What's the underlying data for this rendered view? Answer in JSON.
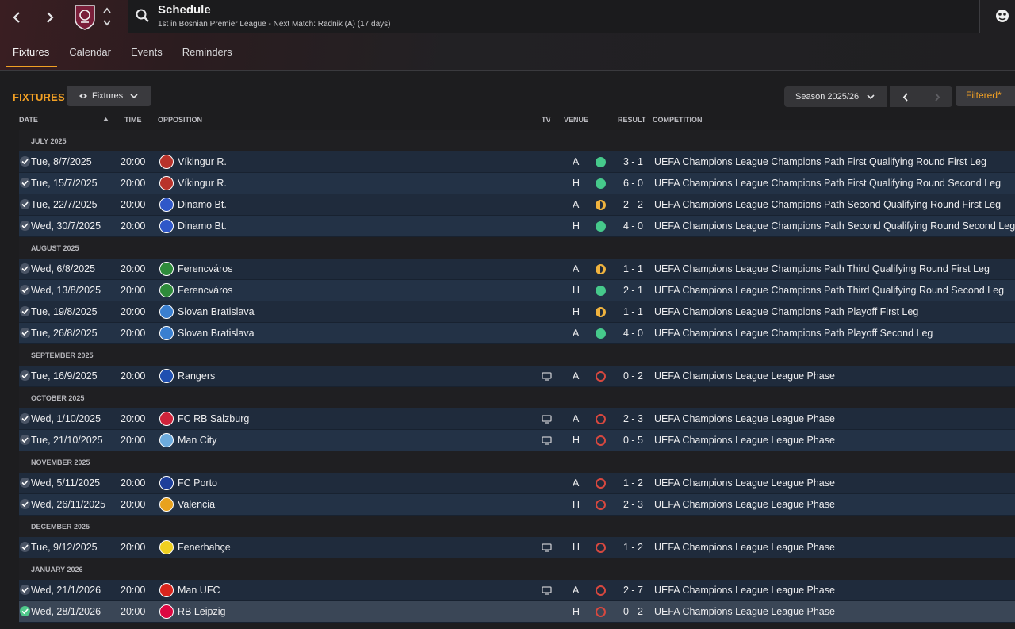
{
  "header": {
    "title": "Schedule",
    "subtitle": "1st in Bosnian Premier League - Next Match: Radnik (A) (17 days)"
  },
  "tabs": [
    {
      "label": "Fixtures",
      "active": true
    },
    {
      "label": "Calendar",
      "active": false
    },
    {
      "label": "Events",
      "active": false
    },
    {
      "label": "Reminders",
      "active": false
    }
  ],
  "toolbar": {
    "heading": "FIXTURES",
    "view_label": "Fixtures",
    "season_label": "Season 2025/26",
    "filter_label": "Filtered*"
  },
  "columns": {
    "date": "DATE",
    "time": "TIME",
    "opposition": "OPPOSITION",
    "tv": "TV",
    "venue": "VENUE",
    "result": "RESULT",
    "competition": "COMPETITION"
  },
  "colors": {
    "accent": "#f2a024",
    "win": "#46c98b",
    "draw": "#f0b33e",
    "loss": "#d8483f"
  },
  "months": [
    {
      "label": "JULY 2025",
      "fixtures": [
        {
          "date": "Tue, 8/7/2025",
          "time": "20:00",
          "opponent": "Víkingur R.",
          "badge_color": "#b8322a",
          "tv": false,
          "venue": "A",
          "outcome": "win",
          "result": "3 - 1",
          "competition": "UEFA Champions League Champions Path First Qualifying Round First Leg"
        },
        {
          "date": "Tue, 15/7/2025",
          "time": "20:00",
          "opponent": "Víkingur R.",
          "badge_color": "#b8322a",
          "tv": false,
          "venue": "H",
          "outcome": "win",
          "result": "6 - 0",
          "competition": "UEFA Champions League Champions Path First Qualifying Round Second Leg"
        },
        {
          "date": "Tue, 22/7/2025",
          "time": "20:00",
          "opponent": "Dinamo Bt.",
          "badge_color": "#2f57c8",
          "tv": false,
          "venue": "A",
          "outcome": "draw",
          "result": "2 - 2",
          "competition": "UEFA Champions League Champions Path Second Qualifying Round First Leg"
        },
        {
          "date": "Wed, 30/7/2025",
          "time": "20:00",
          "opponent": "Dinamo Bt.",
          "badge_color": "#2f57c8",
          "tv": false,
          "venue": "H",
          "outcome": "win",
          "result": "4 - 0",
          "competition": "UEFA Champions League Champions Path Second Qualifying Round Second Leg"
        }
      ]
    },
    {
      "label": "AUGUST 2025",
      "fixtures": [
        {
          "date": "Wed, 6/8/2025",
          "time": "20:00",
          "opponent": "Ferencváros",
          "badge_color": "#2e8b3a",
          "tv": false,
          "venue": "A",
          "outcome": "draw",
          "result": "1 - 1",
          "competition": "UEFA Champions League Champions Path Third Qualifying Round First Leg"
        },
        {
          "date": "Wed, 13/8/2025",
          "time": "20:00",
          "opponent": "Ferencváros",
          "badge_color": "#2e8b3a",
          "tv": false,
          "venue": "H",
          "outcome": "win",
          "result": "2 - 1",
          "competition": "UEFA Champions League Champions Path Third Qualifying Round Second Leg"
        },
        {
          "date": "Tue, 19/8/2025",
          "time": "20:00",
          "opponent": "Slovan Bratislava",
          "badge_color": "#3a7fd0",
          "tv": false,
          "venue": "H",
          "outcome": "draw",
          "result": "1 - 1",
          "competition": "UEFA Champions League Champions Path Playoff First Leg"
        },
        {
          "date": "Tue, 26/8/2025",
          "time": "20:00",
          "opponent": "Slovan Bratislava",
          "badge_color": "#3a7fd0",
          "tv": false,
          "venue": "A",
          "outcome": "win",
          "result": "4 - 0",
          "competition": "UEFA Champions League Champions Path Playoff Second Leg"
        }
      ]
    },
    {
      "label": "SEPTEMBER 2025",
      "fixtures": [
        {
          "date": "Tue, 16/9/2025",
          "time": "20:00",
          "opponent": "Rangers",
          "badge_color": "#1f4fb0",
          "tv": true,
          "venue": "A",
          "outcome": "loss",
          "result": "0 - 2",
          "competition": "UEFA Champions League League Phase"
        }
      ]
    },
    {
      "label": "OCTOBER 2025",
      "fixtures": [
        {
          "date": "Wed, 1/10/2025",
          "time": "20:00",
          "opponent": "FC RB Salzburg",
          "badge_color": "#d0233a",
          "tv": true,
          "venue": "A",
          "outcome": "loss",
          "result": "2 - 3",
          "competition": "UEFA Champions League League Phase"
        },
        {
          "date": "Tue, 21/10/2025",
          "time": "20:00",
          "opponent": "Man City",
          "badge_color": "#6cabdd",
          "tv": true,
          "venue": "H",
          "outcome": "loss",
          "result": "0 - 5",
          "competition": "UEFA Champions League League Phase"
        }
      ]
    },
    {
      "label": "NOVEMBER 2025",
      "fixtures": [
        {
          "date": "Wed, 5/11/2025",
          "time": "20:00",
          "opponent": "FC Porto",
          "badge_color": "#1d3e9a",
          "tv": false,
          "venue": "A",
          "outcome": "loss",
          "result": "1 - 2",
          "competition": "UEFA Champions League League Phase"
        },
        {
          "date": "Wed, 26/11/2025",
          "time": "20:00",
          "opponent": "Valencia",
          "badge_color": "#e8a21e",
          "tv": false,
          "venue": "H",
          "outcome": "loss",
          "result": "2 - 3",
          "competition": "UEFA Champions League League Phase"
        }
      ]
    },
    {
      "label": "DECEMBER 2025",
      "fixtures": [
        {
          "date": "Tue, 9/12/2025",
          "time": "20:00",
          "opponent": "Fenerbahçe",
          "badge_color": "#f0d020",
          "tv": true,
          "venue": "H",
          "outcome": "loss",
          "result": "1 - 2",
          "competition": "UEFA Champions League League Phase"
        }
      ]
    },
    {
      "label": "JANUARY 2026",
      "fixtures": [
        {
          "date": "Wed, 21/1/2026",
          "time": "20:00",
          "opponent": "Man UFC",
          "badge_color": "#d9251d",
          "tv": true,
          "venue": "A",
          "outcome": "loss",
          "result": "2 - 7",
          "competition": "UEFA Champions League League Phase"
        },
        {
          "date": "Wed, 28/1/2026",
          "time": "20:00",
          "opponent": "RB Leipzig",
          "badge_color": "#dd0741",
          "tv": false,
          "venue": "H",
          "outcome": "loss",
          "result": "0 - 2",
          "competition": "UEFA Champions League League Phase",
          "selected": true
        }
      ]
    }
  ]
}
